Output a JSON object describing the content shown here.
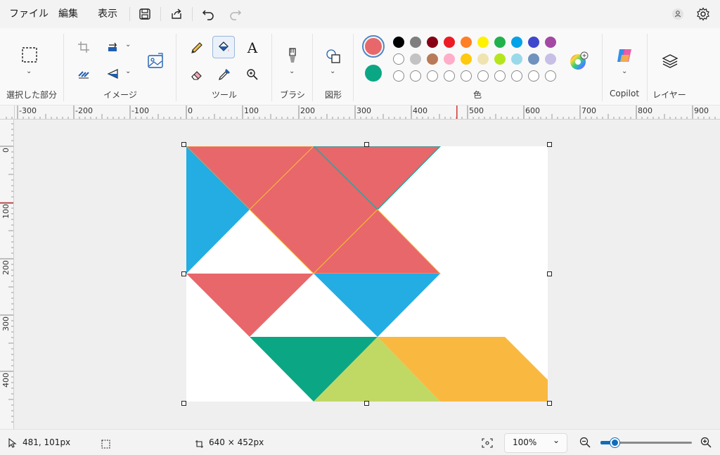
{
  "menu": {
    "file": "ファイル",
    "edit": "編集",
    "view": "表示"
  },
  "toolbar_icons": [
    "save-icon",
    "share-icon",
    "undo-icon",
    "redo-icon",
    "account-icon",
    "settings-icon"
  ],
  "ribbon": {
    "groups": {
      "selection": "選択した部分",
      "image": "イメージ",
      "tools": "ツール",
      "brush": "ブラシ",
      "shapes": "図形",
      "color": "色",
      "copilot": "Copilot",
      "layers": "レイヤー"
    },
    "tools_text_glyph": "A"
  },
  "colors": {
    "primary": "#e8676a",
    "secondary": "#0ba785",
    "palette_row1": [
      "#000000",
      "#7f7f7f",
      "#880015",
      "#ed1c24",
      "#ff7f27",
      "#fff200",
      "#22b14c",
      "#00a2e8",
      "#3f48cc",
      "#a349a4"
    ],
    "palette_row2": [
      "#ffffff",
      "#c3c3c3",
      "#b97a57",
      "#ffaec9",
      "#ffc90e",
      "#efe4b0",
      "#b5e61d",
      "#99d9ea",
      "#7092be",
      "#c8bfe7"
    ],
    "palette_row3_empty_count": 10
  },
  "rulers": {
    "horizontal": [
      "-300",
      "-200",
      "-100",
      "0",
      "100",
      "200",
      "300",
      "400",
      "500",
      "600",
      "700",
      "800",
      "900"
    ],
    "vertical": [
      "0",
      "100",
      "200",
      "300",
      "400"
    ]
  },
  "canvas_shapes": {
    "red": "#e8676a",
    "blue": "#23ade3",
    "green": "#0ba785",
    "lime": "#c0d964",
    "orange": "#f9b940",
    "outline": "#f9b940",
    "outline2": "#2aa6a0"
  },
  "status": {
    "cursor_position": "481, 101px",
    "canvas_size": "640 × 452px",
    "zoom": "100%"
  }
}
